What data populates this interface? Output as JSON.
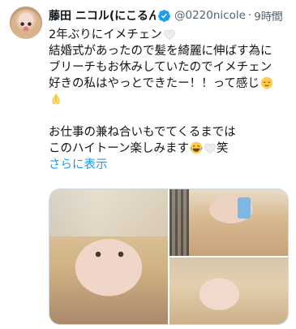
{
  "tweet": {
    "display_name": "藤田 ニコル(にこるん)",
    "handle": "@0220nicole",
    "separator": "·",
    "time": "9時間",
    "more_label": "···",
    "lines": [
      "2年ぶりにイメチェン",
      "結婚式があったので髪を綺麗に伸ばす為に",
      "ブリーチもお休みしていたのでイメチェン",
      "好きの私はやっとできたー！！って感じ",
      "",
      "",
      "お仕事の兼ね合いもでてくるまでは",
      "このハイトーン楽しみます",
      "笑"
    ],
    "show_more": "さらに表示"
  },
  "colors": {
    "accent": "#1d9bf0",
    "secondary_text": "#536471",
    "text": "#0f1419",
    "border": "#cfd9de"
  },
  "icons": [
    "verified-badge-icon",
    "white-heart-icon",
    "relieved-face-icon",
    "folded-hands-icon",
    "laughing-face-icon",
    "more-options-icon"
  ]
}
